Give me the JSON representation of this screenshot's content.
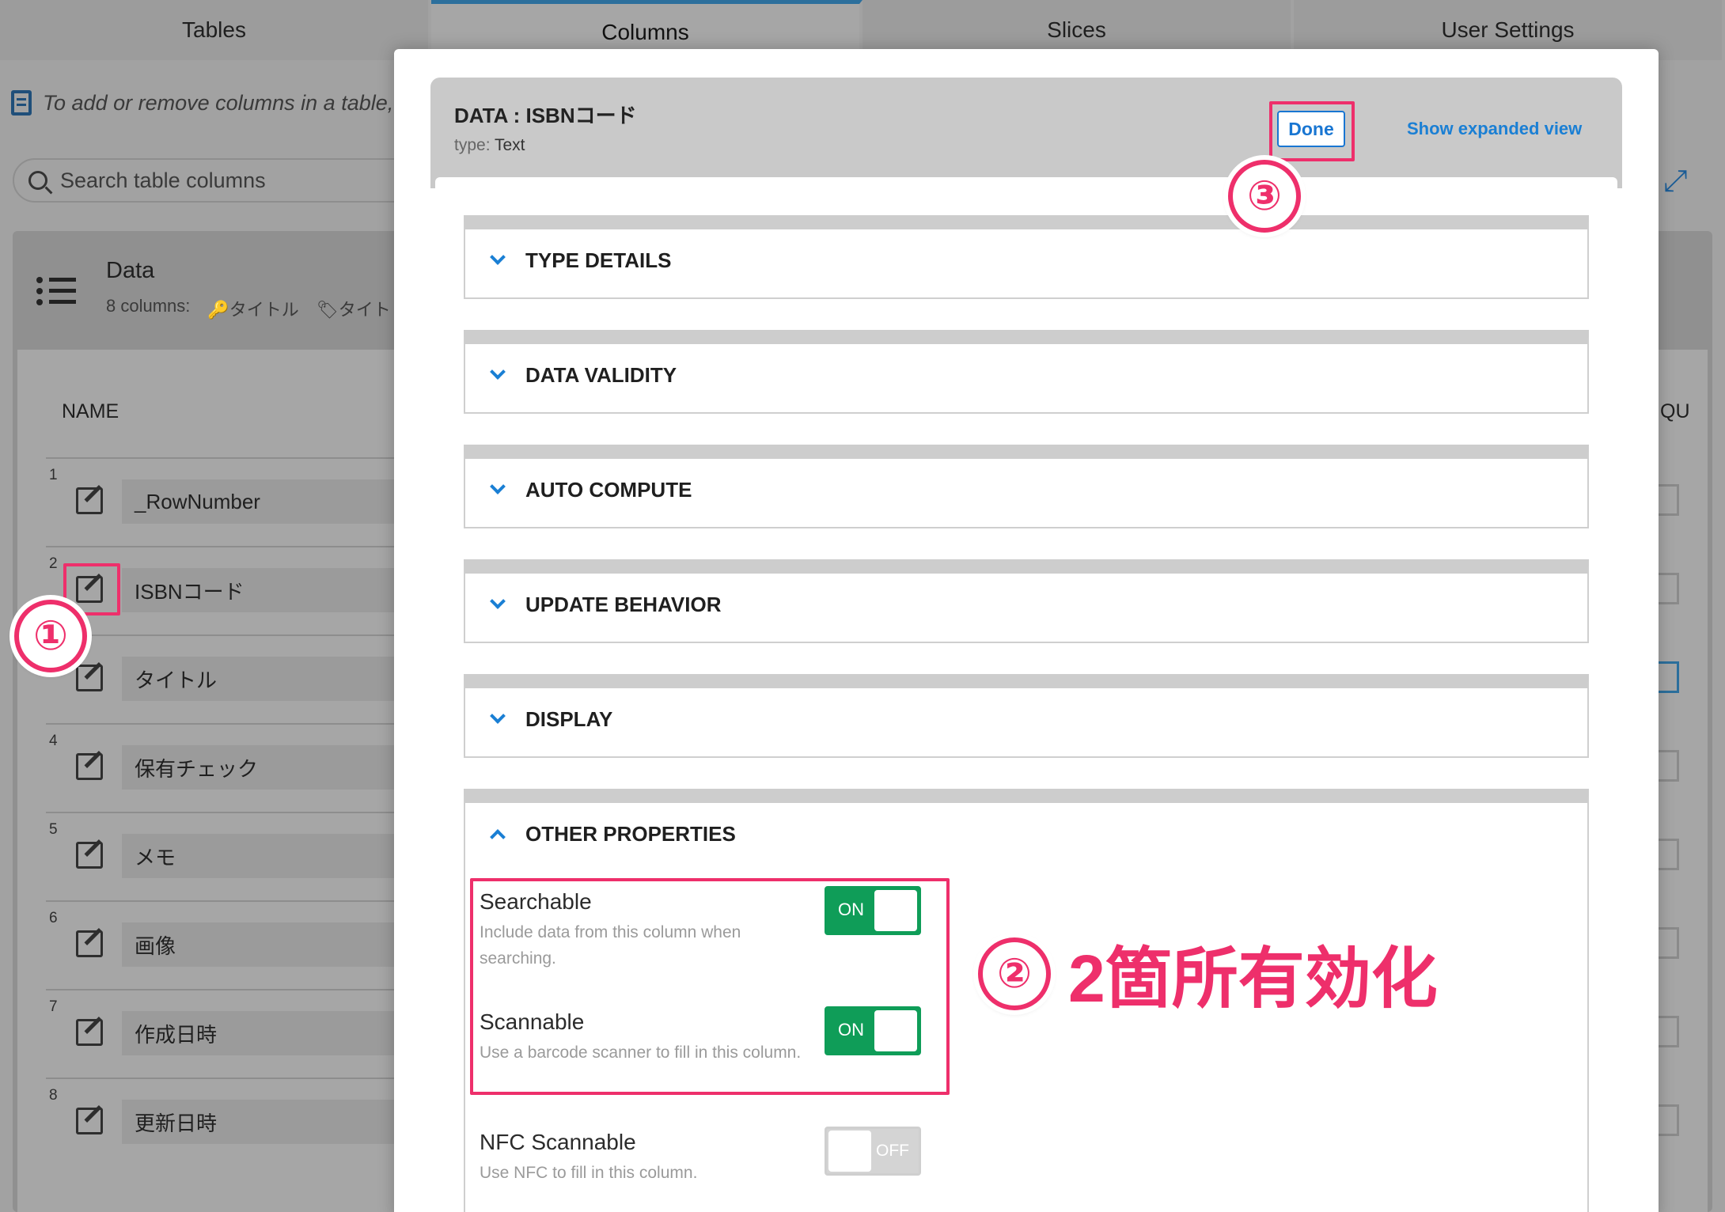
{
  "tabs": [
    {
      "label": "Tables"
    },
    {
      "label": "Columns"
    },
    {
      "label": "Slices"
    },
    {
      "label": "User Settings"
    }
  ],
  "hint_text": "To add or remove columns in a table, c",
  "search": {
    "placeholder": "Search table columns"
  },
  "data_card": {
    "title": "Data",
    "subtitle_count": "8 columns:",
    "subtitle_key": "タイトル",
    "subtitle_label": "タイト"
  },
  "table": {
    "name_header": "NAME",
    "qu_header": "QU",
    "rows": [
      {
        "num": "1",
        "name": "_RowNumber"
      },
      {
        "num": "2",
        "name": "ISBNコード"
      },
      {
        "num": "3",
        "name": "タイトル"
      },
      {
        "num": "4",
        "name": "保有チェック"
      },
      {
        "num": "5",
        "name": "メモ"
      },
      {
        "num": "6",
        "name": "画像"
      },
      {
        "num": "7",
        "name": "作成日時"
      },
      {
        "num": "8",
        "name": "更新日時"
      }
    ]
  },
  "modal": {
    "title": "DATA : ISBNコード",
    "type_label": "type:",
    "type_value": "Text",
    "done_label": "Done",
    "expanded_label": "Show expanded view",
    "sections": [
      {
        "label": "TYPE DETAILS"
      },
      {
        "label": "DATA VALIDITY"
      },
      {
        "label": "AUTO COMPUTE"
      },
      {
        "label": "UPDATE BEHAVIOR"
      },
      {
        "label": "DISPLAY"
      },
      {
        "label": "OTHER PROPERTIES"
      }
    ],
    "properties": [
      {
        "title": "Searchable",
        "desc": "Include data from this column when searching.",
        "state": "ON"
      },
      {
        "title": "Scannable",
        "desc": "Use a barcode scanner to fill in this column.",
        "state": "ON"
      },
      {
        "title": "NFC Scannable",
        "desc": "Use NFC to fill in this column.",
        "state": "OFF"
      }
    ]
  },
  "annotations": {
    "step1": "①",
    "step2": "②",
    "step3": "③",
    "step2_text": "2箇所有効化",
    "highlight_color": "#ee2f6b"
  },
  "colors": {
    "accent": "#1a7fd4",
    "toggle_on": "#0f9d58"
  }
}
